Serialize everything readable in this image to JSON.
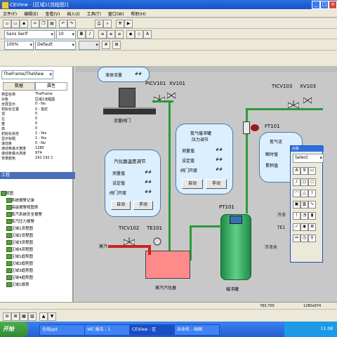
{
  "window": {
    "title": "CEView - [区域1(流程图)]",
    "minimize": "_",
    "restore": "□",
    "close": "×"
  },
  "menu": [
    "文件(F)",
    "编辑(E)",
    "查看(V)",
    "插入(I)",
    "工具(T)",
    "窗口(W)",
    "帮助(H)"
  ],
  "font_toolbar": {
    "font": "Sans Serif",
    "size": "10",
    "bold": "B",
    "italic": "I"
  },
  "zoom_toolbar": {
    "zoom": "100%",
    "layer": "Default"
  },
  "left_panel": {
    "selector": "TheFrame/TheView",
    "tabs": [
      "数据",
      "属性"
    ],
    "properties": [
      {
        "k": "类型名称",
        "v": "TheFrame"
      },
      {
        "k": "对象",
        "v": "区域1流程图"
      },
      {
        "k": "全屏显示",
        "v": "0 - No"
      },
      {
        "k": "初始化位置",
        "v": "0 - 指定"
      },
      {
        "k": "顶",
        "v": "0"
      },
      {
        "k": "左",
        "v": "0"
      },
      {
        "k": "宽",
        "v": "0"
      },
      {
        "k": "高",
        "v": "0"
      },
      {
        "k": "初始化状态",
        "v": "1 - Yes"
      },
      {
        "k": "显示标题",
        "v": "1 - Yes"
      },
      {
        "k": "滚动条",
        "v": "0 - No"
      },
      {
        "k": "滚动条最大宽度",
        "v": "1280"
      },
      {
        "k": "滚动条最大高度",
        "v": "974"
      },
      {
        "k": "背景颜色",
        "v": "192 192 1"
      }
    ],
    "tree_title": "工程",
    "tree": [
      "视图",
      "系统报警记录",
      "高级报警视图表",
      "蒸汽系统安全报警",
      "蒸汽压力报警",
      "区域1流程图",
      "区域2流程图",
      "区域3流程图",
      "区域4流程图",
      "区域1趋势图",
      "区域2趋势图",
      "区域3趋势图",
      "区域4趋势图",
      "区域1报表"
    ]
  },
  "diagram": {
    "tank_top": {
      "title": "液体流量",
      "value": "##",
      "caption": "流量阀门"
    },
    "valves": {
      "pic": "PICV101",
      "xv1": "XV101",
      "tic3": "TICV103",
      "xv3": "XV103",
      "tic2": "TICV102",
      "te": "TE101",
      "pt": "PT101",
      "ft": "FT101"
    },
    "heater_box": {
      "title": "汽化器温度调节",
      "rows": [
        {
          "label": "测量值",
          "value": "##"
        },
        {
          "label": "设定值",
          "value": "##"
        },
        {
          "label": "阀门开度",
          "value": "##"
        }
      ],
      "auto": "自动",
      "manual": "手动"
    },
    "pressure_box": {
      "title1": "氮气缓冲罐",
      "title2": "压力调节",
      "rows": [
        {
          "label": "测量值",
          "value": "##"
        },
        {
          "label": "设定值",
          "value": "##"
        },
        {
          "label": "阀门开度",
          "value": "##"
        }
      ],
      "auto": "自动",
      "manual": "手动"
    },
    "flow_box": {
      "title": "氮气流",
      "row1": "瞬时值",
      "row2": "累积值",
      "value": "##"
    },
    "steam_label": "蒸汽",
    "heater_label": "蒸汽汽化器",
    "buffer_label": "缓冲罐",
    "right_label1": "冷冻",
    "right_label2": "TE1",
    "cold_water": "冷冻水"
  },
  "toolbox": {
    "title": "对象",
    "select": "Select"
  },
  "status": {
    "coords": "780,700",
    "res": "1280x974"
  },
  "taskbar": {
    "start": "开始",
    "tasks": [
      "全局ppt",
      "WE 报告 - 1",
      "CEView - 区",
      "未命名 - 画图"
    ],
    "time": "11:08"
  }
}
